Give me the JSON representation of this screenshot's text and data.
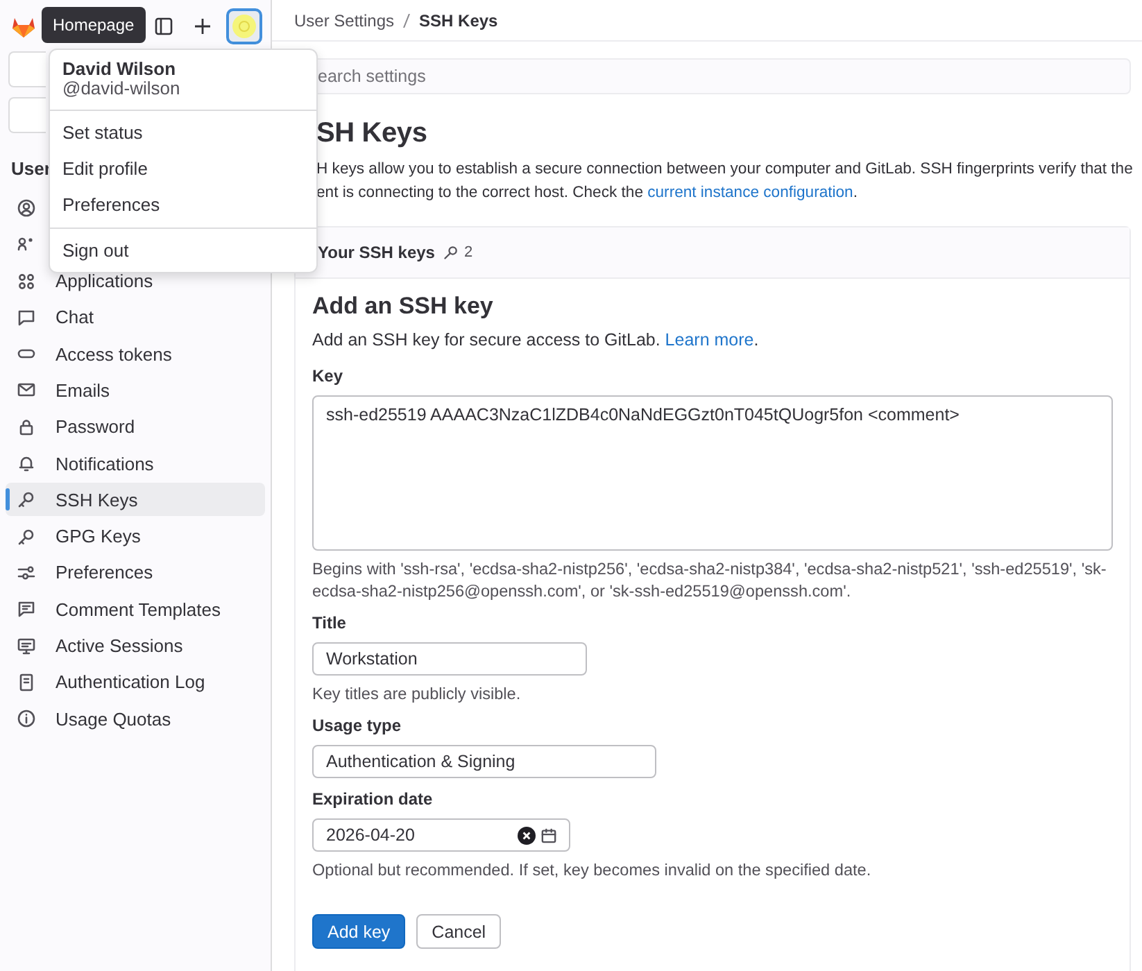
{
  "top_bar": {
    "tooltip": "Homepage"
  },
  "sidebar": {
    "heading": "User",
    "items": [
      {
        "selected": false
      },
      {
        "selected": false
      },
      {
        "label": "Applications",
        "selected": false
      },
      {
        "label": "Chat",
        "selected": false
      },
      {
        "label": "Access tokens",
        "selected": false
      },
      {
        "label": "Emails",
        "selected": false
      },
      {
        "label": "Password",
        "selected": false
      },
      {
        "label": "Notifications",
        "selected": false
      },
      {
        "label": "SSH Keys",
        "selected": true
      },
      {
        "label": "GPG Keys",
        "selected": false
      },
      {
        "label": "Preferences",
        "selected": false
      },
      {
        "label": "Comment Templates",
        "selected": false
      },
      {
        "label": "Active Sessions",
        "selected": false
      },
      {
        "label": "Authentication Log",
        "selected": false
      },
      {
        "label": "Usage Quotas",
        "selected": false
      }
    ]
  },
  "user_menu": {
    "name": "David Wilson",
    "handle": "@david-wilson",
    "sections": [
      [
        "Set status",
        "Edit profile",
        "Preferences"
      ],
      [
        "Sign out"
      ]
    ]
  },
  "breadcrumb": [
    {
      "label": "User Settings",
      "current": false
    },
    {
      "label": "SSH Keys",
      "current": true
    }
  ],
  "search": {
    "placeholder": "earch settings"
  },
  "page_title": "SH Keys",
  "description": {
    "line_1": "H keys allow you to establish a secure connection between your computer and GitLab. SSH fingerprints verify that the",
    "line_2": "ent is connecting to the correct host. Check the ",
    "link": "current instance configuration",
    "end": "."
  },
  "keys_card": {
    "title": "Your SSH keys",
    "count": "2"
  },
  "form": {
    "title": "Add an SSH key",
    "intro": "Add an SSH key for secure access to GitLab. ",
    "intro_link": "Learn more",
    "intro_end": ".",
    "fields": [
      {
        "kind": "textarea",
        "label": "Key",
        "value": "ssh-ed25519 AAAAC3NzaC1lZDB4c0NaNdEGGzt0nT045tQUogr5fon <comment>",
        "help": "Begins with 'ssh-rsa', 'ecdsa-sha2-nistp256', 'ecdsa-sha2-nistp384', 'ecdsa-sha2-nistp521', 'ssh-ed25519', 'sk-ecdsa-sha2-nistp256@openssh.com', or 'sk-ssh-ed25519@openssh.com'."
      },
      {
        "kind": "text",
        "label": "Title",
        "value": "Workstation",
        "help": "Key titles are publicly visible."
      },
      {
        "kind": "select",
        "label": "Usage type",
        "value": "Authentication & Signing"
      },
      {
        "kind": "date",
        "label": "Expiration date",
        "value": "2026-04-20",
        "help": "Optional but recommended. If set, key becomes invalid on the specified date."
      }
    ],
    "buttons": [
      {
        "label": "Add key",
        "kind": "primary"
      },
      {
        "label": "Cancel",
        "kind": "secondary"
      }
    ]
  }
}
